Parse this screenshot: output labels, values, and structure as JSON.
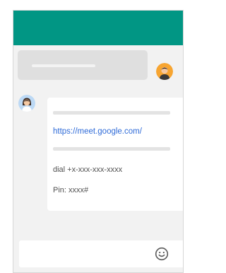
{
  "chat": {
    "meeting_card": {
      "link": "https://meet.google.com/",
      "dial": "dial +x-xxx-xxx-xxxx",
      "pin": "Pin: xxxx#"
    }
  },
  "icons": {
    "emoji": "emoji-icon",
    "user_avatar": "avatar-man",
    "contact_avatar": "avatar-woman"
  },
  "colors": {
    "app_bar": "#019684",
    "link": "#2f6bd8",
    "avatar_orange": "#f7a531",
    "avatar_blue": "#bcd9f5"
  }
}
